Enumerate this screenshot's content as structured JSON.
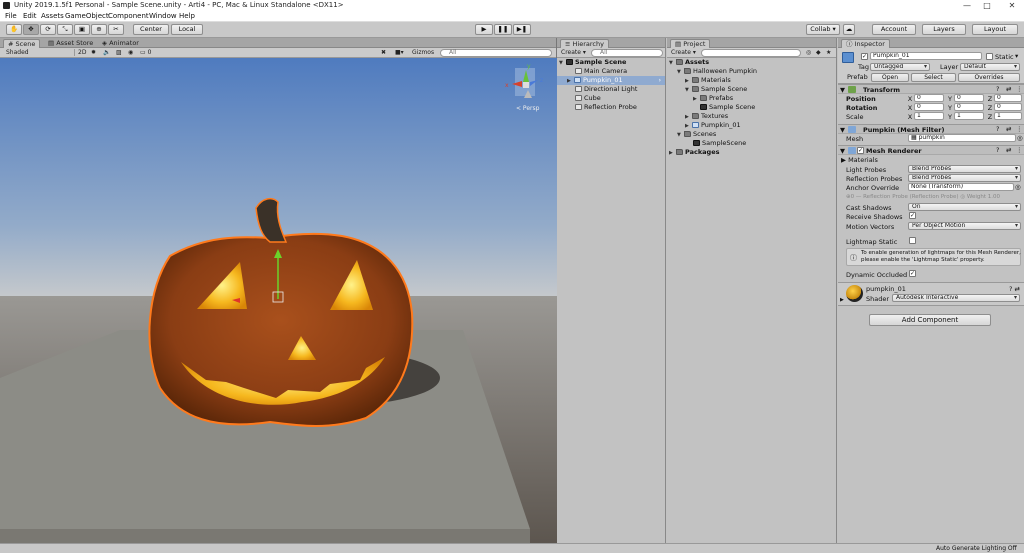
{
  "window": {
    "title": "Unity 2019.1.5f1 Personal - Sample Scene.unity - Arti4 - PC, Mac & Linux Standalone <DX11>",
    "minimize": "—",
    "maximize": "□",
    "close": "✕"
  },
  "menu": [
    "File",
    "Edit",
    "Assets",
    "GameObject",
    "Component",
    "Window",
    "Help"
  ],
  "toolbar": {
    "tools": [
      "hand-tool",
      "move-tool",
      "rotate-tool",
      "scale-tool",
      "rect-tool",
      "transform-tool",
      "custom-tool"
    ],
    "pivot_label": "Center",
    "space_label": "Local",
    "play_symbol": "▶",
    "pause_symbol": "❚❚",
    "step_symbol": "▶❚",
    "collab_label": "Collab ▾",
    "account_label": "Account",
    "layers_label": "Layers",
    "layout_label": "Layout"
  },
  "scene": {
    "tabs": [
      "Scene",
      "Asset Store",
      "Animator"
    ],
    "shading": "Shaded",
    "mode_2d": "2D",
    "audio_count": "0",
    "gizmos_label": "Gizmos",
    "search_placeholder": "All",
    "persp_label": "< Persp",
    "gizmo_axes": {
      "y": "y",
      "x": "x",
      "z": "z"
    }
  },
  "hierarchy": {
    "tab": "Hierarchy",
    "create_label": "Create ▾",
    "search_placeholder": "All",
    "scene_name": "Sample Scene",
    "items": [
      "Main Camera",
      "Pumpkin_01",
      "Directional Light",
      "Cube",
      "Reflection Probe"
    ]
  },
  "project": {
    "tab": "Project",
    "create_label": "Create ▾",
    "items": [
      {
        "label": "Assets",
        "depth": 0,
        "bold": true
      },
      {
        "label": "Halloween Pumpkin",
        "depth": 1
      },
      {
        "label": "Materials",
        "depth": 2
      },
      {
        "label": "Sample Scene",
        "depth": 2
      },
      {
        "label": "Prefabs",
        "depth": 3
      },
      {
        "label": "Sample Scene",
        "depth": 3
      },
      {
        "label": "Textures",
        "depth": 2
      },
      {
        "label": "Pumpkin_01",
        "depth": 2
      },
      {
        "label": "Scenes",
        "depth": 1
      },
      {
        "label": "SampleScene",
        "depth": 2
      },
      {
        "label": "Packages",
        "depth": 0,
        "bold": true
      }
    ]
  },
  "inspector": {
    "tab": "Inspector",
    "object_name": "Pumpkin_01",
    "static_label": "Static",
    "tag_label": "Tag",
    "tag_value": "Untagged",
    "layer_label": "Layer",
    "layer_value": "Default",
    "prefab_label": "Prefab",
    "prefab_open": "Open",
    "prefab_select": "Select",
    "prefab_overrides": "Overrides",
    "transform": {
      "title": "Transform",
      "position_label": "Position",
      "rotation_label": "Rotation",
      "scale_label": "Scale",
      "axis_x": "X",
      "axis_y": "Y",
      "axis_z": "Z",
      "position": [
        "0",
        "0",
        "0"
      ],
      "rotation": [
        "0",
        "0",
        "0"
      ],
      "scale": [
        "1",
        "1",
        "1"
      ]
    },
    "mesh_filter": {
      "title": "Pumpkin (Mesh Filter)",
      "mesh_label": "Mesh",
      "mesh_value": "pumpkin"
    },
    "mesh_renderer": {
      "title": "Mesh Renderer",
      "materials_label": "Materials",
      "light_probes_label": "Light Probes",
      "light_probes_value": "Blend Probes",
      "reflection_probes_label": "Reflection Probes",
      "reflection_probes_value": "Blend Probes",
      "anchor_override_label": "Anchor Override",
      "anchor_override_value": "None (Transform)",
      "reflection_probe_field": "Reflection Probe (Reflection Probe)",
      "weight_label": "Weight 1.00",
      "cast_shadows_label": "Cast Shadows",
      "cast_shadows_value": "On",
      "receive_shadows_label": "Receive Shadows",
      "motion_vectors_label": "Motion Vectors",
      "motion_vectors_value": "Per Object Motion",
      "lightmap_static_label": "Lightmap Static",
      "info_line1": "To enable generation of lightmaps for this Mesh Renderer,",
      "info_line2": "please enable the 'Lightmap Static' property.",
      "dynamic_occluded_label": "Dynamic Occluded"
    },
    "material": {
      "name": "pumpkin_01",
      "shader_label": "Shader",
      "shader_value": "Autodesk Interactive"
    },
    "add_component": "Add Component"
  },
  "status": {
    "text": "Auto Generate Lighting Off"
  },
  "colors": {
    "accent_selection": "#3d6fb3",
    "pumpkin": "#b5561b",
    "sky": "#5f88c5",
    "ground": "#8b8b85"
  }
}
